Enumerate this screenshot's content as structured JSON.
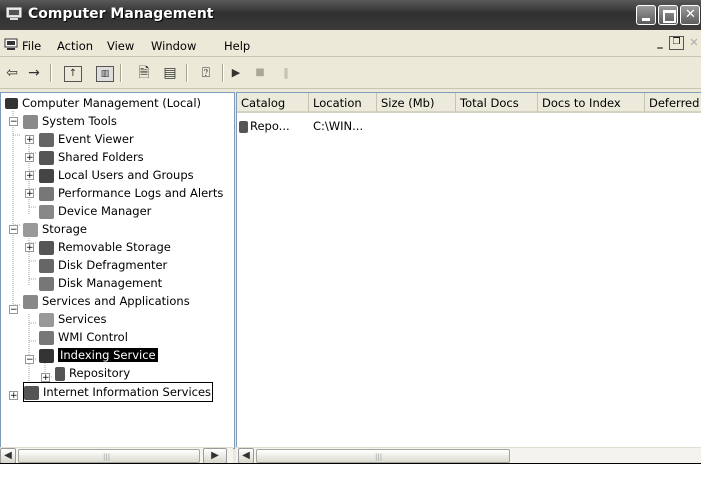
{
  "window": {
    "title": "Computer Management"
  },
  "menu": {
    "items": [
      "File",
      "Action",
      "View",
      "Window",
      "Help"
    ]
  },
  "tree": {
    "root": "Computer Management (Local)",
    "system_tools": "System Tools",
    "event_viewer": "Event Viewer",
    "shared_folders": "Shared Folders",
    "local_users": "Local Users and Groups",
    "perf_logs": "Performance Logs and Alerts",
    "device_manager": "Device Manager",
    "storage": "Storage",
    "removable_storage": "Removable Storage",
    "disk_defrag": "Disk Defragmenter",
    "disk_mgmt": "Disk Management",
    "services_apps": "Services and Applications",
    "services": "Services",
    "wmi": "WMI Control",
    "indexing": "Indexing Service",
    "repository": "Repository",
    "iis": "Internet Information Services"
  },
  "list": {
    "columns": [
      "Catalog",
      "Location",
      "Size (Mb)",
      "Total Docs",
      "Docs to Index",
      "Deferred"
    ],
    "rows": [
      {
        "catalog": "Repo...",
        "location": "C:\\WIN..."
      }
    ]
  },
  "icons": {
    "window": "computer-management-icon",
    "back": "back-arrow-icon",
    "forward": "forward-arrow-icon",
    "up": "up-folder-icon",
    "show_tree": "show-hide-tree-icon",
    "properties": "properties-icon",
    "export": "export-list-icon",
    "help": "help-icon",
    "play": "start-icon",
    "stop": "stop-icon",
    "pause": "pause-icon"
  },
  "colors": {
    "titlebar": "#3c3c3c",
    "selection": "#000000",
    "pane_border": "#7f9db9"
  }
}
